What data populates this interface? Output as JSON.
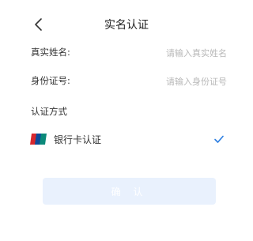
{
  "header": {
    "title": "实名认证",
    "back_icon": "chevron-left-icon"
  },
  "form": {
    "name": {
      "label": "真实姓名:",
      "value": "",
      "placeholder": "请输入真实姓名"
    },
    "id_number": {
      "label": "身份证号:",
      "value": "",
      "placeholder": "请输入身份证号"
    }
  },
  "verification": {
    "section_label": "认证方式",
    "methods": [
      {
        "label": "银行卡认证",
        "icon": "unionpay-icon",
        "selected": true
      }
    ]
  },
  "confirm_button": {
    "label": "确 认",
    "enabled": false
  },
  "colors": {
    "accent": "#2a7de1",
    "button_disabled_bg": "#e9f1fd"
  }
}
